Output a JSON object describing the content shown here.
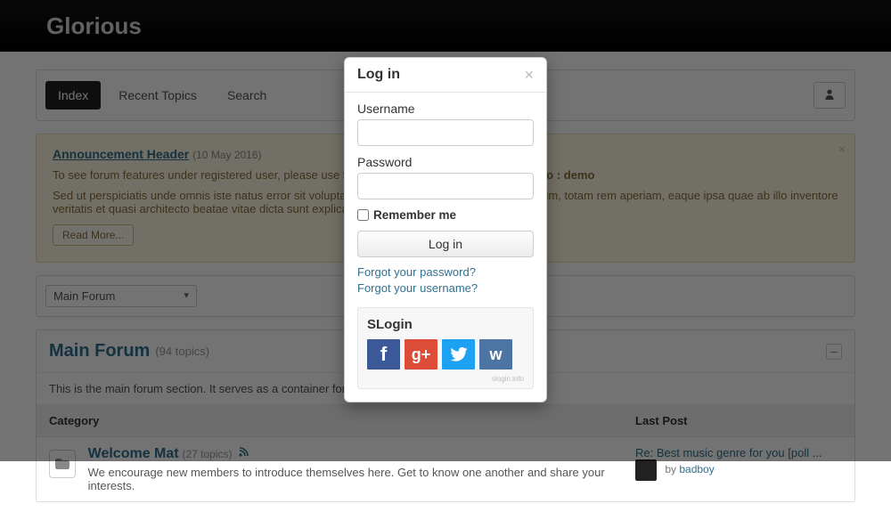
{
  "brand": "Glorious",
  "nav": {
    "tabs": [
      {
        "label": "Index",
        "active": true
      },
      {
        "label": "Recent Topics",
        "active": false
      },
      {
        "label": "Search",
        "active": false
      }
    ]
  },
  "announcement": {
    "header": "Announcement Header",
    "timestamp": "(10 May 2016)",
    "cred_line_prefix": "To see forum features under registered user, please use the following credentials to sign in: ",
    "cred_line_creds": "demo : demo",
    "body": "Sed ut perspiciatis unde omnis iste natus error sit voluptatem accusantium doloremque laudantium, totam rem aperiam, eaque ipsa quae ab illo inventore veritatis et quasi architecto beatae vitae dicta sunt explicabo.",
    "readmore": "Read More...",
    "close": "×"
  },
  "forum_select": {
    "value": "Main Forum"
  },
  "main_forum": {
    "title": "Main Forum",
    "count": "(94 topics)",
    "desc": "This is the main forum section. It serves as a container for categories for your topics.",
    "collapse": "–"
  },
  "columns": {
    "category": "Category",
    "lastpost": "Last Post"
  },
  "row1": {
    "title": "Welcome Mat",
    "meta": "(27 topics)",
    "desc": "We encourage new members to introduce themselves here. Get to know one another and share your interests.",
    "lp_title": "Re: Best music genre for you [poll ...",
    "lp_by_prefix": "by ",
    "lp_by": "badboy"
  },
  "modal": {
    "title": "Log in",
    "username_label": "Username",
    "password_label": "Password",
    "remember": "Remember me",
    "login_btn": "Log in",
    "forgot_pw": "Forgot your password?",
    "forgot_un": "Forgot your username?",
    "slogin_title": "SLogin",
    "slogin_footer": "slogin.info",
    "social": {
      "fb": "f",
      "gp": "g+",
      "vk": "w"
    }
  }
}
